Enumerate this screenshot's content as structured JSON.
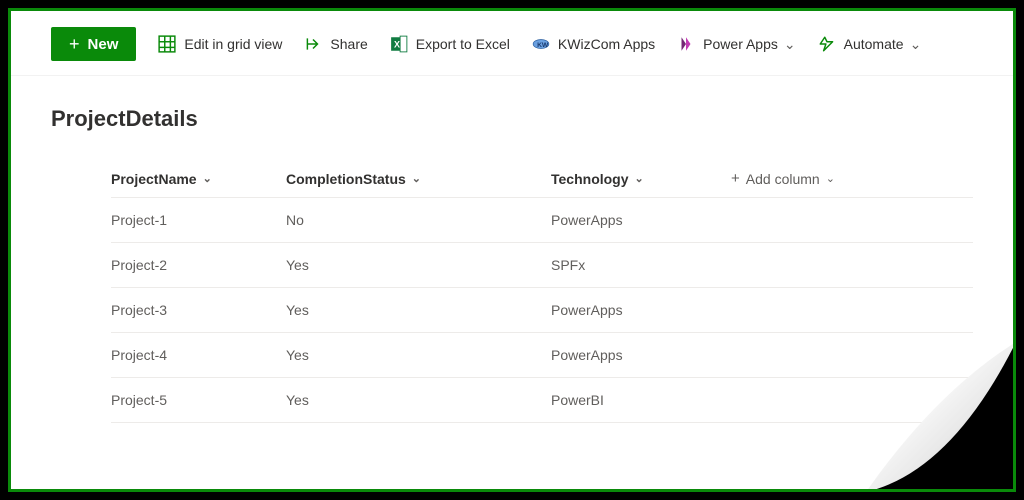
{
  "toolbar": {
    "new_label": "New",
    "edit_grid_label": "Edit in grid view",
    "share_label": "Share",
    "export_label": "Export to Excel",
    "kwizcom_label": "KWizCom Apps",
    "powerapps_label": "Power Apps",
    "automate_label": "Automate"
  },
  "list": {
    "title": "ProjectDetails",
    "columns": {
      "c0": "ProjectName",
      "c1": "CompletionStatus",
      "c2": "Technology",
      "add": "Add column"
    },
    "rows": [
      {
        "name": "Project-1",
        "status": "No",
        "tech": "PowerApps"
      },
      {
        "name": "Project-2",
        "status": "Yes",
        "tech": "SPFx"
      },
      {
        "name": "Project-3",
        "status": "Yes",
        "tech": "PowerApps"
      },
      {
        "name": "Project-4",
        "status": "Yes",
        "tech": "PowerApps"
      },
      {
        "name": "Project-5",
        "status": "Yes",
        "tech": "PowerBI"
      }
    ]
  },
  "colors": {
    "accent": "#0a8a0a"
  }
}
